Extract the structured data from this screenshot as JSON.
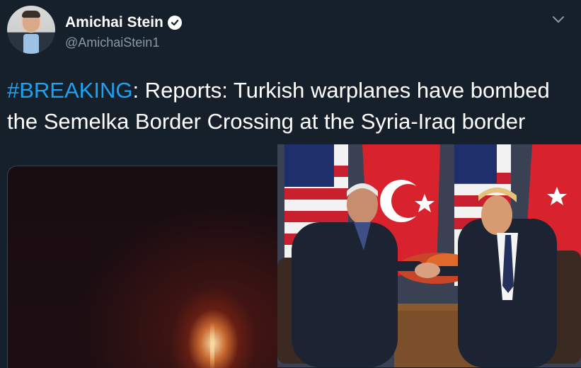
{
  "tweet": {
    "author_name": "Amichai Stein",
    "handle": "@AmichaiStein1",
    "hashtag": "#BREAKING",
    "text_after_hashtag": ": Reports: Turkish warplanes have bombed the Semelka Border Crossing at the Syria-Iraq border"
  },
  "colors": {
    "background": "#15202b",
    "link": "#1da1f2",
    "secondary_text": "#8899a6"
  },
  "icons": {
    "verified": "verified-badge-icon",
    "menu": "chevron-down-icon"
  }
}
